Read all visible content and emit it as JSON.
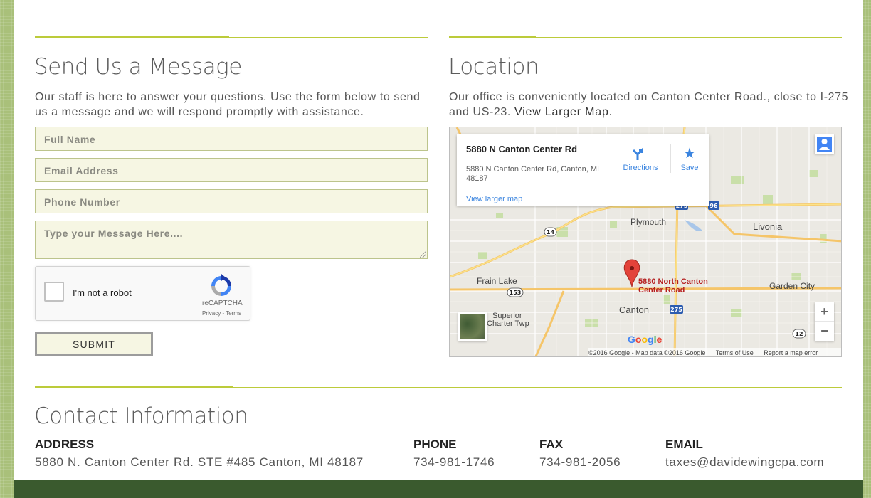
{
  "message_section": {
    "heading": "Send Us a Message",
    "intro": "Our staff is here to answer your questions. Use the form below to send us a message and we will respond promptly with assistance.",
    "fields": {
      "full_name_placeholder": "Full Name",
      "email_placeholder": "Email Address",
      "phone_placeholder": "Phone Number",
      "message_placeholder": "Type your Message Here...."
    },
    "recaptcha": {
      "label": "I'm not a robot",
      "brand": "reCAPTCHA",
      "links": "Privacy - Terms",
      "checked": false
    },
    "submit_label": "SUBMIT"
  },
  "location_section": {
    "heading": "Location",
    "intro": "Our office is conveniently located on Canton Center Road., close to I-275 and US-23.",
    "view_map_link": "View Larger Map.",
    "map": {
      "card_title": "5880 N Canton Center Rd",
      "card_address": "5880 N Canton Center Rd, Canton, MI 48187",
      "directions_label": "Directions",
      "save_label": "Save",
      "view_larger_label": "View larger map",
      "places": {
        "plymouth": "Plymouth",
        "livonia": "Livonia",
        "frain_lake": "Frain Lake",
        "garden_city": "Garden City",
        "canton": "Canton",
        "superior": "Superior",
        "charter_twp": "Charter Twp"
      },
      "pin_label_line1": "5880 North Canton",
      "pin_label_line2": "Center Road",
      "shields": [
        "275",
        "96",
        "14",
        "153",
        "275",
        "12"
      ],
      "google_logo": "Google",
      "attribution": "©2016 Google - Map data ©2016 Google",
      "terms": "Terms of Use",
      "report": "Report a map error",
      "zoom_in": "+",
      "zoom_out": "−"
    }
  },
  "contact_section": {
    "heading": "Contact Information",
    "address_label": "ADDRESS",
    "address_value": "5880 N. Canton Center Rd. STE #485 Canton, MI 48187",
    "phone_label": "PHONE",
    "phone_value": "734-981-1746",
    "fax_label": "FAX",
    "fax_value": "734-981-2056",
    "email_label": "EMAIL",
    "email_value": "taxes@davidewingcpa.com"
  },
  "colors": {
    "accent": "#bccb3a",
    "field_bg": "#f6f6e3",
    "footer": "#3a5a2e",
    "page_bg": "#a9c07a",
    "pin": "#e3433a"
  }
}
